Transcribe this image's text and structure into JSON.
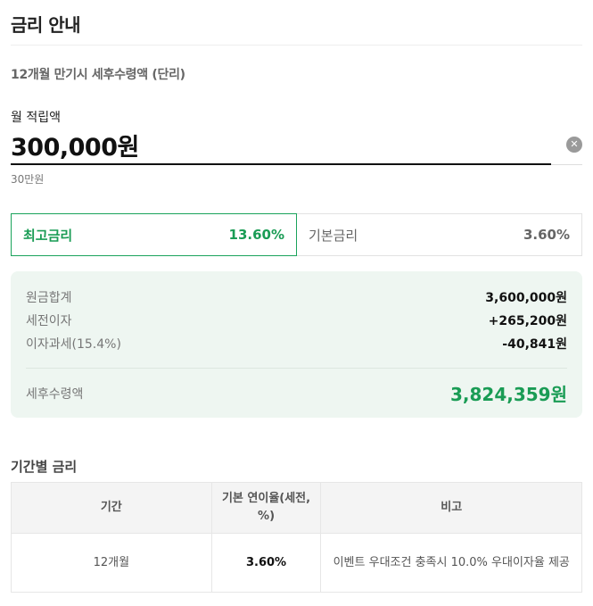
{
  "header": {
    "title": "금리 안내"
  },
  "subtitle": "12개월 만기시 세후수령액 (단리)",
  "amount": {
    "label": "월 적립액",
    "value": "300,000원",
    "hint": "30만원",
    "clear_icon": "close-circle-icon"
  },
  "tabs": [
    {
      "label": "최고금리",
      "rate": "13.60%",
      "selected": true
    },
    {
      "label": "기본금리",
      "rate": "3.60%",
      "selected": false
    }
  ],
  "summary": {
    "rows": [
      {
        "label": "원금합계",
        "value": "3,600,000원"
      },
      {
        "label": "세전이자",
        "value": "+265,200원"
      },
      {
        "label": "이자과세(15.4%)",
        "value": "-40,841원"
      }
    ],
    "total": {
      "label": "세후수령액",
      "value": "3,824,359원"
    }
  },
  "rates_section": {
    "title": "기간별 금리",
    "headers": [
      "기간",
      "기본 연이율(세전, %)",
      "비고"
    ],
    "rows": [
      {
        "period": "12개월",
        "rate": "3.60%",
        "note": "이벤트 우대조건 충족시 10.0% 우대이자율 제공"
      }
    ]
  },
  "colors": {
    "accent": "#1a9c55",
    "summary_bg": "#eef6f1"
  }
}
